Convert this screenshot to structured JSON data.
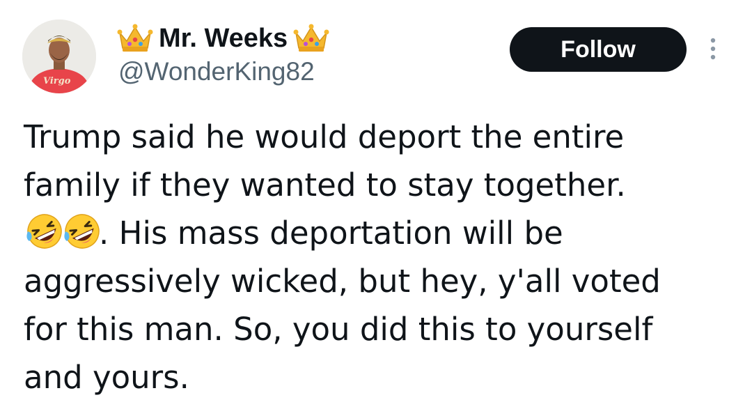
{
  "author": {
    "display_name": "Mr. Weeks",
    "handle": "@WonderKing82",
    "name_decoration": "crown-emoji",
    "avatar": {
      "description_icon": "avatar-photo",
      "shirt_text": "Virgo"
    }
  },
  "actions": {
    "follow_label": "Follow",
    "more_icon": "more-vertical-icon"
  },
  "tweet": {
    "line1": "Trump said he would deport the entire",
    "line2": "family if they wanted to stay together.",
    "line3_emoji": "rolling-on-floor-laughing-emoji",
    "line3_text": ". His mass deportation will be",
    "line4": "aggressively wicked, but hey, y'all voted",
    "line5": "for this man. So, you did this to yourself",
    "line6": "and yours."
  },
  "colors": {
    "text": "#0f1419",
    "secondary_text": "#536471",
    "follow_bg": "#0f1419",
    "follow_text": "#ffffff",
    "more_icon": "#8b98a5",
    "avatar_shirt": "#e8444a",
    "crown_gold": "#f5b82e"
  }
}
